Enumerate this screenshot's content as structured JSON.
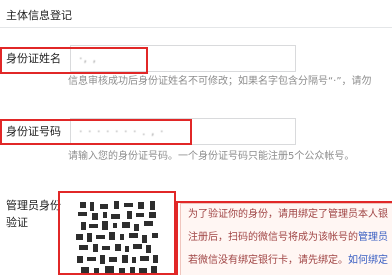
{
  "section": {
    "title": "主体信息登记"
  },
  "name_field": {
    "label": "身份证姓名",
    "value": "·, ,",
    "tip": "信息审核成功后身份证姓名不可修改；如果名字包含分隔号“·”，请勿"
  },
  "id_field": {
    "label": "身份证号码",
    "value": "·  ·   ·   ·   ·   ·   ·   .    ,   ·",
    "tip": "请输入您的身份证号码。一个身份证号码只能注册5个公众帐号。"
  },
  "admin_verify": {
    "label_line1": "管理员身份",
    "label_line2": "验证",
    "qr_icon": "qr-code-icon",
    "notice": {
      "line1": "为了验证你的身份，请用绑定了管理员本人银",
      "line2_prefix": "注册后，扫码的微信号将成为该帐号的",
      "line2_link": "管理员",
      "line3_prefix": "若微信没有绑定银行卡，请先绑定。",
      "line3_link": "如何绑定"
    }
  },
  "colors": {
    "highlight_box": "#e12727",
    "notice_bg": "#fff6f3",
    "link": "#3a5fc2"
  }
}
